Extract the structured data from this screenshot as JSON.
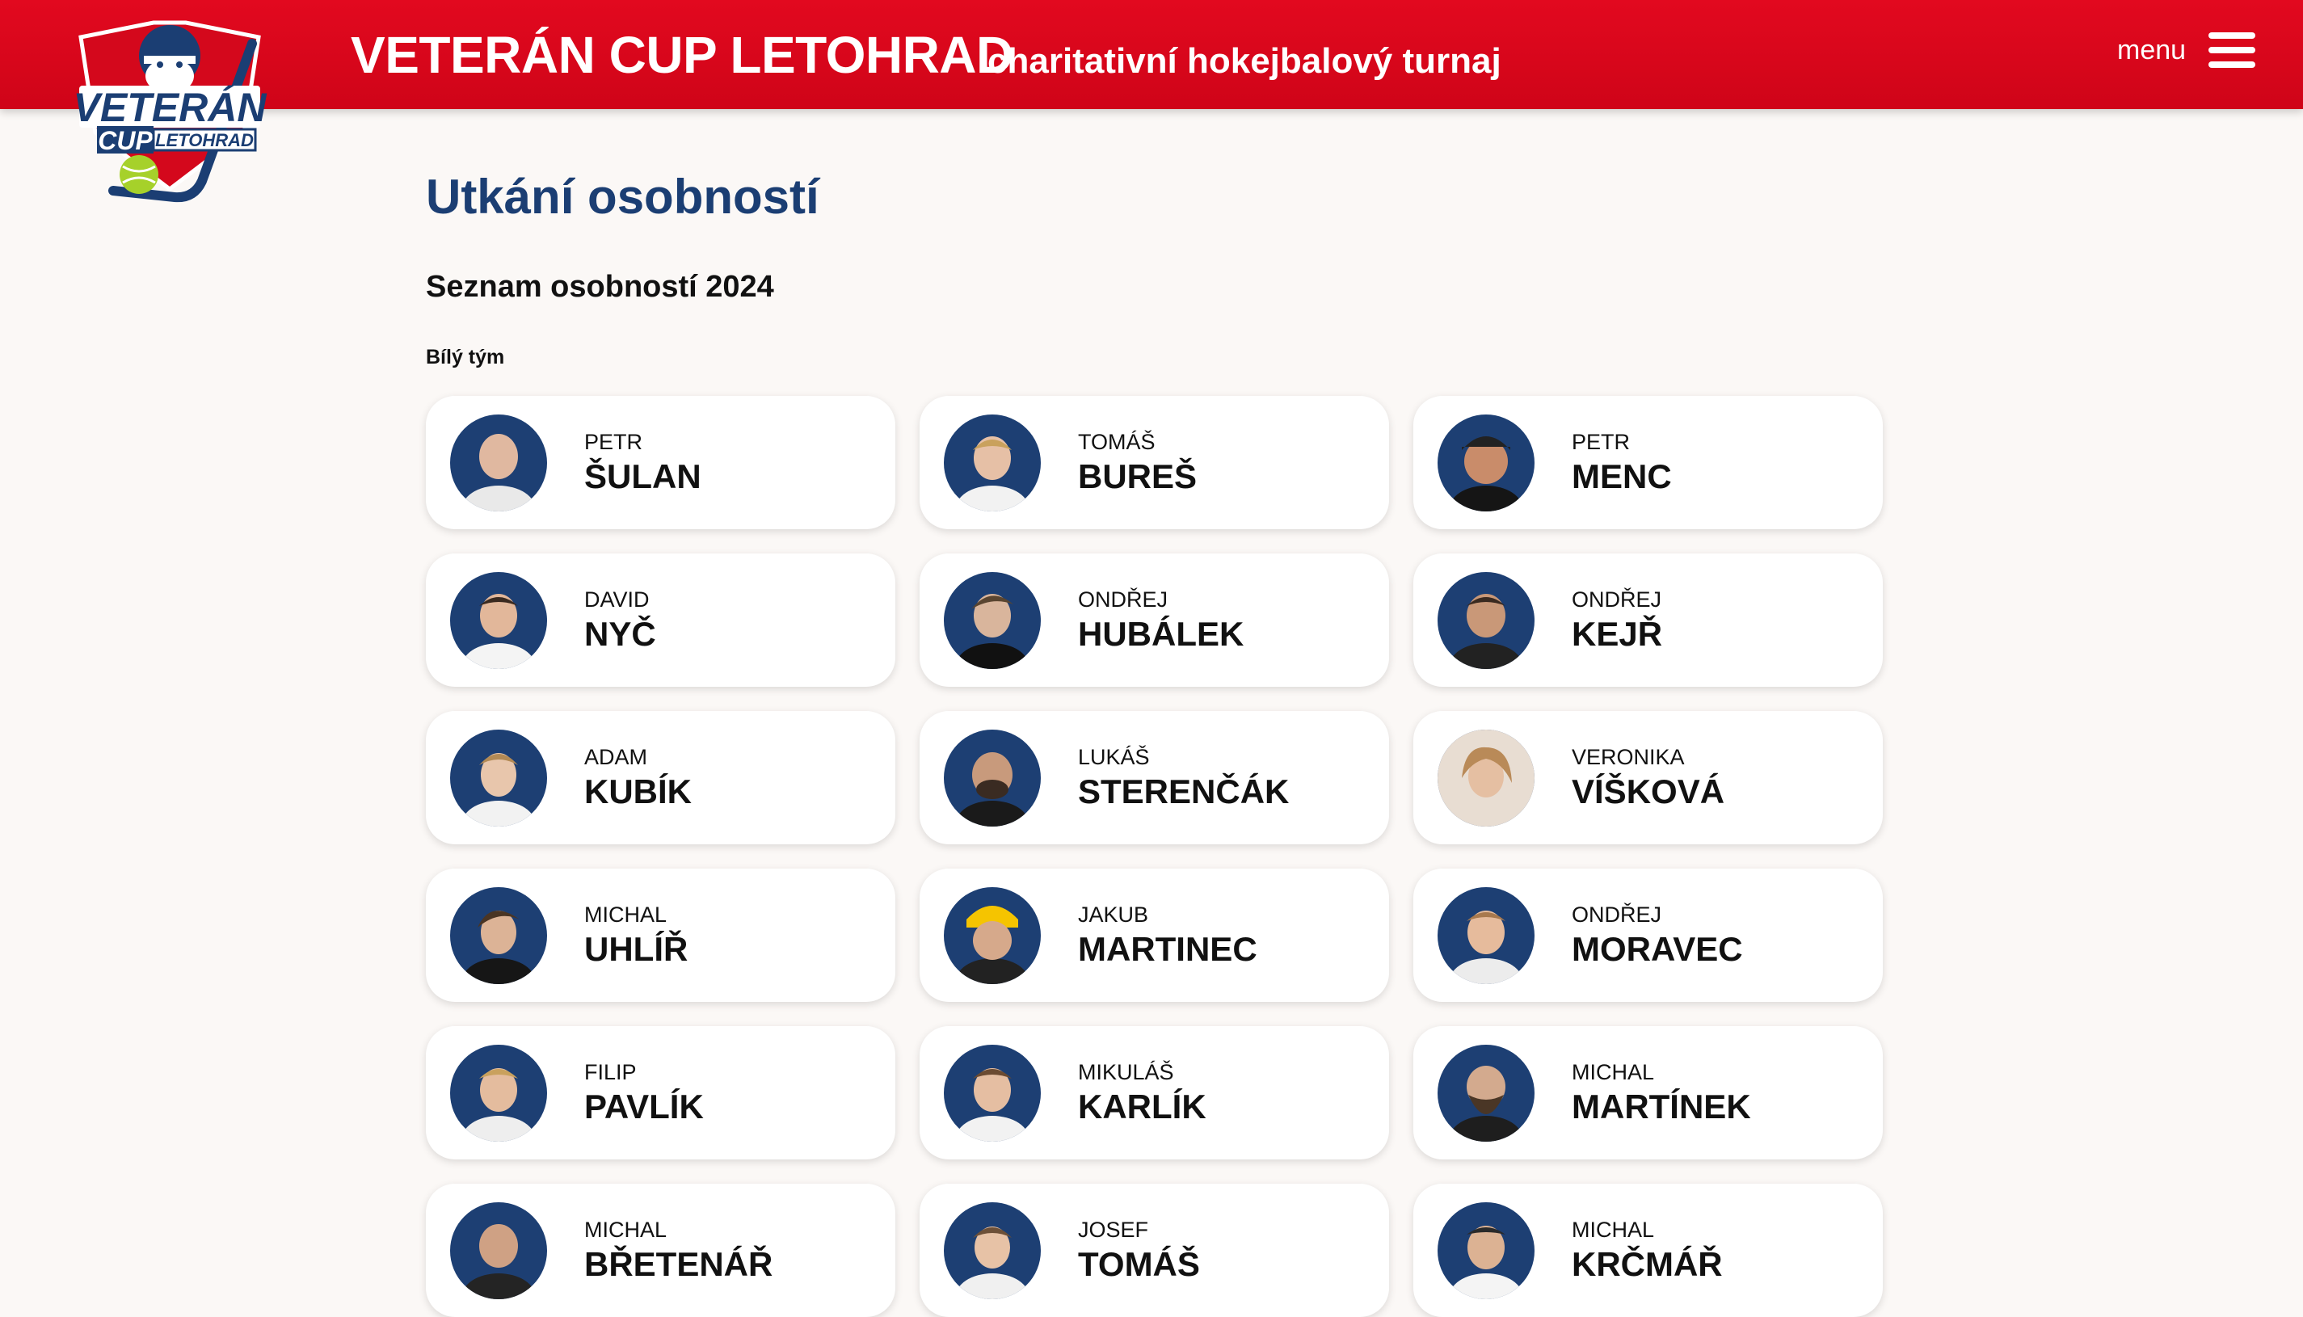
{
  "header": {
    "title": "VETERÁN CUP LETOHRAD",
    "subtitle": "charitativní hokejbalový turnaj",
    "menu_label": "menu",
    "logo": {
      "line1": "VETERÁN",
      "line2": "CUP",
      "line3": "LETOHRAD"
    }
  },
  "colors": {
    "header_red": "#e2091f",
    "heading_blue": "#1b3e73",
    "avatar_bg": "#1d3f73",
    "page_bg": "#fbf8f6"
  },
  "main": {
    "heading": "Utkání osobností",
    "list_heading": "Seznam osobností 2024",
    "team_label": "Bílý tým",
    "players": [
      {
        "first": "PETR",
        "last": "ŠULAN"
      },
      {
        "first": "TOMÁŠ",
        "last": "BUREŠ"
      },
      {
        "first": "PETR",
        "last": "MENC"
      },
      {
        "first": "DAVID",
        "last": "NYČ"
      },
      {
        "first": "ONDŘEJ",
        "last": "HUBÁLEK"
      },
      {
        "first": "ONDŘEJ",
        "last": "KEJŘ"
      },
      {
        "first": "ADAM",
        "last": "KUBÍK"
      },
      {
        "first": "LUKÁŠ",
        "last": "STERENČÁK"
      },
      {
        "first": "VERONIKA",
        "last": "VÍŠKOVÁ"
      },
      {
        "first": "MICHAL",
        "last": "UHLÍŘ"
      },
      {
        "first": "JAKUB",
        "last": "MARTINEC"
      },
      {
        "first": "ONDŘEJ",
        "last": "MORAVEC"
      },
      {
        "first": "FILIP",
        "last": "PAVLÍK"
      },
      {
        "first": "MIKULÁŠ",
        "last": "KARLÍK"
      },
      {
        "first": "MICHAL",
        "last": "MARTÍNEK"
      },
      {
        "first": "MICHAL",
        "last": "BŘETENÁŘ"
      },
      {
        "first": "JOSEF",
        "last": "TOMÁŠ"
      },
      {
        "first": "MICHAL",
        "last": "KRČMÁŘ"
      }
    ]
  }
}
